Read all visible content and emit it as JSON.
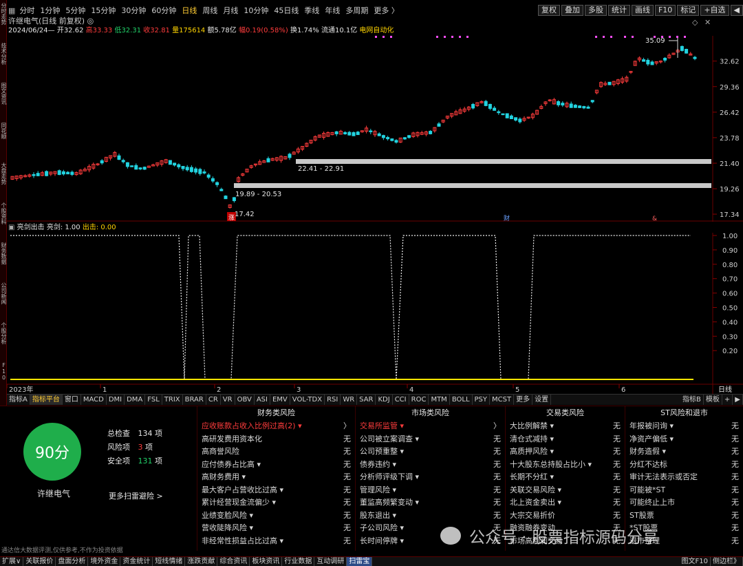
{
  "left_tabs": [
    "分时走势",
    "技术分析",
    "图文资讯",
    "同花顺",
    "大盘走势",
    "个股资料",
    "财务数据",
    "公司新闻",
    "个股分析",
    "F10"
  ],
  "period_bar": {
    "items": [
      "分时",
      "1分钟",
      "5分钟",
      "15分钟",
      "30分钟",
      "60分钟",
      "日线",
      "周线",
      "月线",
      "10分钟",
      "45日线",
      "季线",
      "年线",
      "多周期",
      "更多 〉"
    ],
    "active": "日线",
    "right_buttons": [
      "复权",
      "叠加",
      "多股",
      "统计",
      "画线",
      "F10",
      "标记",
      "+自选",
      "◀"
    ]
  },
  "stock_info": "许继电气(日线 前复权) ◎",
  "quote": {
    "date_open": "2024/06/24— 开32.62",
    "high": "高33.33",
    "low": "低32.31",
    "close": "收32.81",
    "volume": "量175614",
    "amount": "额5.78亿",
    "change": "幅0.19(0.58%)",
    "turnover": "换1.74%",
    "float_cap": "流通10.1亿",
    "sector": "电网自动化"
  },
  "main_chart": {
    "price_axis": [
      "32.62",
      "29.36",
      "26.42",
      "23.78",
      "21.40",
      "19.26",
      "17.34"
    ],
    "annotations": {
      "peak": "35.09",
      "zone_upper": "22.41 - 22.91",
      "zone_lower": "19.89 - 20.53",
      "low": "17.42"
    },
    "markers": [
      "涨",
      "财",
      "&"
    ]
  },
  "sub_chart": {
    "title": "亮剑出击",
    "line_label": "亮剑: 1.00",
    "signal_label": "出击: 0.00",
    "axis": [
      "1.00",
      "0.90",
      "0.80",
      "0.70",
      "0.60",
      "0.50",
      "0.40",
      "0.30",
      "0.20"
    ],
    "time_axis": [
      "2023年",
      "1",
      "2",
      "3",
      "4",
      "5",
      "6"
    ],
    "period_label": "日线"
  },
  "chart_data": {
    "type": "line",
    "title": "亮剑出击",
    "x": [
      "2023年",
      "1",
      "2",
      "3",
      "4",
      "5",
      "6"
    ],
    "series": [
      {
        "name": "亮剑",
        "values": [
          1,
          1,
          0,
          1,
          0,
          1,
          1,
          1,
          1,
          1,
          0,
          1,
          1,
          1,
          1,
          1,
          1,
          0,
          1,
          1,
          1,
          1,
          0,
          1,
          1,
          1,
          1,
          1,
          1,
          1
        ]
      },
      {
        "name": "出击",
        "values": [
          0,
          0,
          0,
          0,
          0,
          0,
          0,
          0,
          0,
          0,
          0,
          0,
          0,
          0,
          0,
          0,
          0,
          0,
          0,
          0,
          0,
          0,
          0,
          0,
          0,
          0,
          0,
          0,
          0,
          0
        ]
      }
    ],
    "ylim": [
      0,
      1
    ],
    "grid": true
  },
  "indicator_tabs": {
    "items": [
      "指标A",
      "指标平台",
      "窗口",
      "MACD",
      "DMI",
      "DMA",
      "FSL",
      "TRIX",
      "BRAR",
      "CR",
      "VR",
      "OBV",
      "ASI",
      "EMV",
      "VOL-TDX",
      "RSI",
      "WR",
      "SAR",
      "KDJ",
      "CCI",
      "ROC",
      "MTM",
      "BOLL",
      "PSY",
      "MCST",
      "更多",
      "设置"
    ],
    "active": "指标平台",
    "right": [
      "指标B",
      "模板",
      "+",
      "▶"
    ]
  },
  "scan": {
    "score": "90分",
    "stock_name": "许继电气",
    "total_label": "总检查",
    "total_value": "134",
    "total_unit": "项",
    "risk_label": "风险项",
    "risk_value": "3",
    "risk_unit": "项",
    "safe_label": "安全项",
    "safe_value": "131",
    "safe_unit": "项",
    "more_link": "更多扫雷避险 >",
    "disclaimer": "通达信大数据评测,仅供参考,不作为投资依据"
  },
  "risk_columns": [
    {
      "title": "财务类风险",
      "rows": [
        {
          "label": "应收账款占收入比例过高(2) ▾",
          "value": "〉",
          "hot": true
        },
        {
          "label": "高研发费用资本化",
          "value": "无"
        },
        {
          "label": "高商誉风险",
          "value": "无"
        },
        {
          "label": "应付债券占比高 ▾",
          "value": "无"
        },
        {
          "label": "高财务费用 ▾",
          "value": "无"
        },
        {
          "label": "最大客户占营收比过高 ▾",
          "value": "无"
        },
        {
          "label": "累计经营现金流偏少 ▾",
          "value": "无"
        },
        {
          "label": "业绩变脸风险 ▾",
          "value": "无"
        },
        {
          "label": "营收陡降风险 ▾",
          "value": "无"
        },
        {
          "label": "非经常性损益占比过高 ▾",
          "value": "无"
        }
      ]
    },
    {
      "title": "市场类风险",
      "rows": [
        {
          "label": "交易所监管 ▾",
          "value": "〉",
          "hot": true
        },
        {
          "label": "公司被立案调查 ▾",
          "value": "无"
        },
        {
          "label": "公司预重整 ▾",
          "value": "无"
        },
        {
          "label": "债券违约 ▾",
          "value": "无"
        },
        {
          "label": "分析师评级下调 ▾",
          "value": "无"
        },
        {
          "label": "管理风险 ▾",
          "value": "无"
        },
        {
          "label": "董监高频繁变动 ▾",
          "value": "无"
        },
        {
          "label": "股东退出 ▾",
          "value": "无"
        },
        {
          "label": "子公司风险 ▾",
          "value": "无"
        },
        {
          "label": "长时间停牌 ▾",
          "value": "无"
        }
      ]
    },
    {
      "title": "交易类风险",
      "rows": [
        {
          "label": "大比例解禁 ▾",
          "value": "无"
        },
        {
          "label": "清仓式减持 ▾",
          "value": "无"
        },
        {
          "label": "高质押风险 ▾",
          "value": "无"
        },
        {
          "label": "十大股东总持股占比小 ▾",
          "value": "无"
        },
        {
          "label": "长期不分红 ▾",
          "value": "无"
        },
        {
          "label": "关联交易风险 ▾",
          "value": "无"
        },
        {
          "label": "北上资金卖出 ▾",
          "value": "无"
        },
        {
          "label": "大宗交易折价",
          "value": "无"
        },
        {
          "label": "融资融券变动",
          "value": "无"
        },
        {
          "label": "市场高利润交易",
          "value": "无"
        }
      ]
    },
    {
      "title": "ST风险和退市",
      "rows": [
        {
          "label": "年报被问询 ▾",
          "value": "无"
        },
        {
          "label": "净资产偏低 ▾",
          "value": "无"
        },
        {
          "label": "财务造假 ▾",
          "value": "无"
        },
        {
          "label": "分红不达标",
          "value": "无"
        },
        {
          "label": "审计无法表示或否定",
          "value": "无"
        },
        {
          "label": "可能被*ST",
          "value": "无"
        },
        {
          "label": "可能终止上市",
          "value": "无"
        },
        {
          "label": "ST股票",
          "value": "无"
        },
        {
          "label": "*ST股票",
          "value": "无"
        },
        {
          "label": "退市整理",
          "value": "无"
        }
      ]
    }
  ],
  "watermark": "公众号 · 股票指标源码分享",
  "bottom_bar": {
    "items": [
      "扩展∨",
      "关联报价",
      "盘面分析",
      "境外资金",
      "资金统计",
      "短线情绪",
      "涨跌贡献",
      "综合资讯",
      "板块资讯",
      "行业数据",
      "互动调研",
      "扫雷宝"
    ],
    "active": "扫雷宝",
    "right": [
      "图文F10",
      "侧边栏》"
    ]
  },
  "colors": {
    "up": "#ff3c3c",
    "down": "#22d3e0",
    "score_circle": "#1fae4b",
    "accent": "#ffcc33"
  }
}
